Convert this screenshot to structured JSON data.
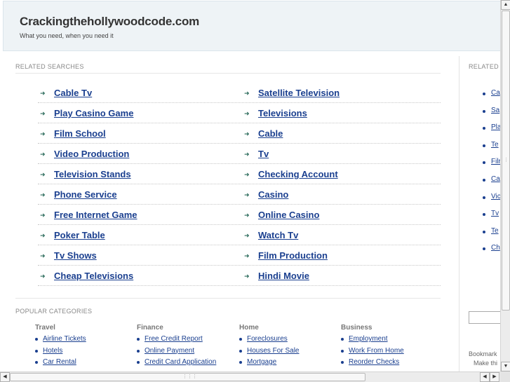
{
  "header": {
    "title": "Crackingthehollywoodcode.com",
    "tagline": "What you need, when you need it"
  },
  "related": {
    "label": "RELATED SEARCHES",
    "rows": [
      [
        "Cable Tv",
        "Satellite Television"
      ],
      [
        "Play Casino Game",
        "Televisions"
      ],
      [
        "Film School",
        "Cable"
      ],
      [
        "Video Production",
        "Tv"
      ],
      [
        "Television Stands",
        "Checking Account"
      ],
      [
        "Phone Service",
        "Casino"
      ],
      [
        "Free Internet Game",
        "Online Casino"
      ],
      [
        "Poker Table",
        "Watch Tv"
      ],
      [
        "Tv Shows",
        "Film Production"
      ],
      [
        "Cheap Televisions",
        "Hindi Movie"
      ]
    ]
  },
  "popular": {
    "label": "POPULAR CATEGORIES",
    "columns": [
      {
        "title": "Travel",
        "items": [
          "Airline Tickets",
          "Hotels",
          "Car Rental"
        ]
      },
      {
        "title": "Finance",
        "items": [
          "Free Credit Report",
          "Online Payment",
          "Credit Card Application"
        ]
      },
      {
        "title": "Home",
        "items": [
          "Foreclosures",
          "Houses For Sale",
          "Mortgage"
        ]
      },
      {
        "title": "Business",
        "items": [
          "Employment",
          "Work From Home",
          "Reorder Checks"
        ]
      }
    ]
  },
  "sidebar": {
    "label": "RELATED",
    "items": [
      "Ca",
      "Sa",
      "Pla",
      "Te",
      "Filr",
      "Ca",
      "Vic",
      "Tv",
      "Te",
      "Ch"
    ],
    "bookmark": "Bookmark",
    "make_this": "Make thi"
  },
  "scroll": {
    "up": "▲",
    "down": "▼",
    "left": "◀",
    "right": "▶"
  }
}
